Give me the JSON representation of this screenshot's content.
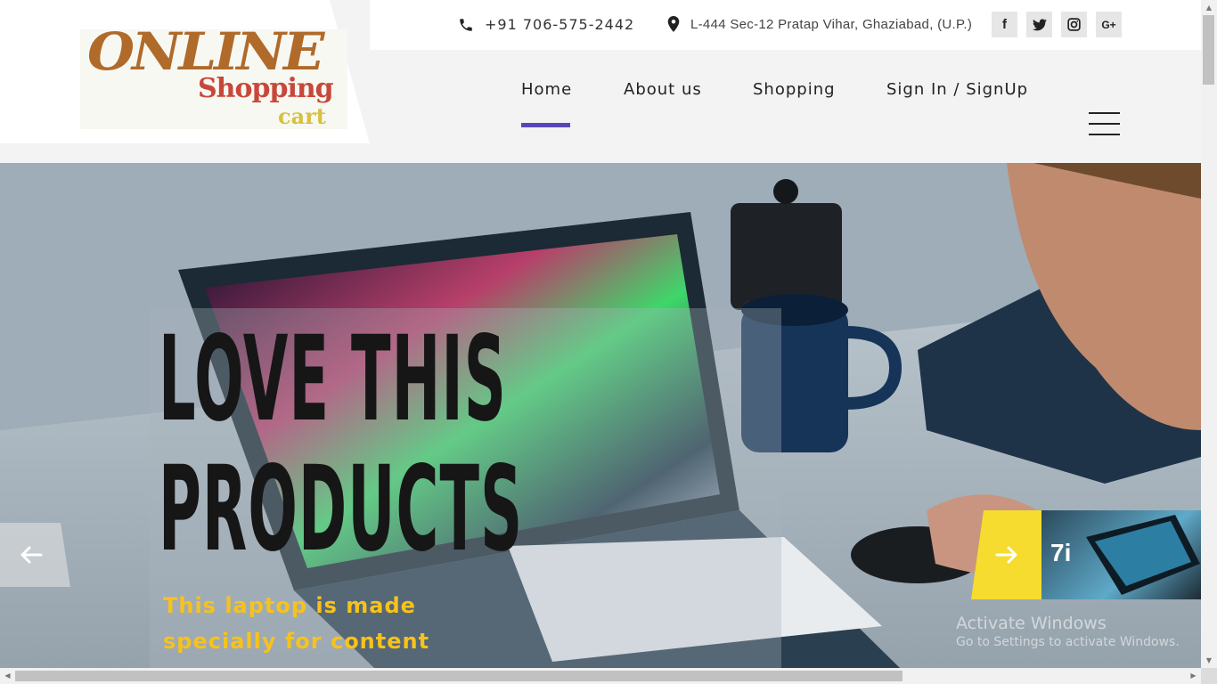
{
  "logo": {
    "line1": "ONLINE",
    "line2": "Shopping",
    "line3": "cart"
  },
  "contact": {
    "phone": "+91 706-575-2442",
    "address": "L-444 Sec-12 Pratap Vihar, Ghaziabad, (U.P.)",
    "phone_icon": "phone-icon",
    "address_icon": "map-pin-icon"
  },
  "social": {
    "facebook": "f",
    "google_plus": "G+"
  },
  "nav": {
    "home": "Home",
    "about": "About us",
    "shopping": "Shopping",
    "signin": "Sign In / SignUp"
  },
  "hero": {
    "title_line1": "LOVE THIS",
    "title_line2": "PRODUCTS",
    "description": "This laptop is made specially for content"
  },
  "next_slide": {
    "thumb_label": "7i"
  },
  "watermark": {
    "line1": "Activate Windows",
    "line2": "Go to Settings to activate Windows."
  },
  "colors": {
    "accent": "#5b46b8",
    "hero_desc": "#f7c21b",
    "next_arrow": "#f6dc2e",
    "logo_brown": "#b06a2a",
    "logo_red": "#c7483a",
    "logo_yellow": "#d6c23e"
  }
}
